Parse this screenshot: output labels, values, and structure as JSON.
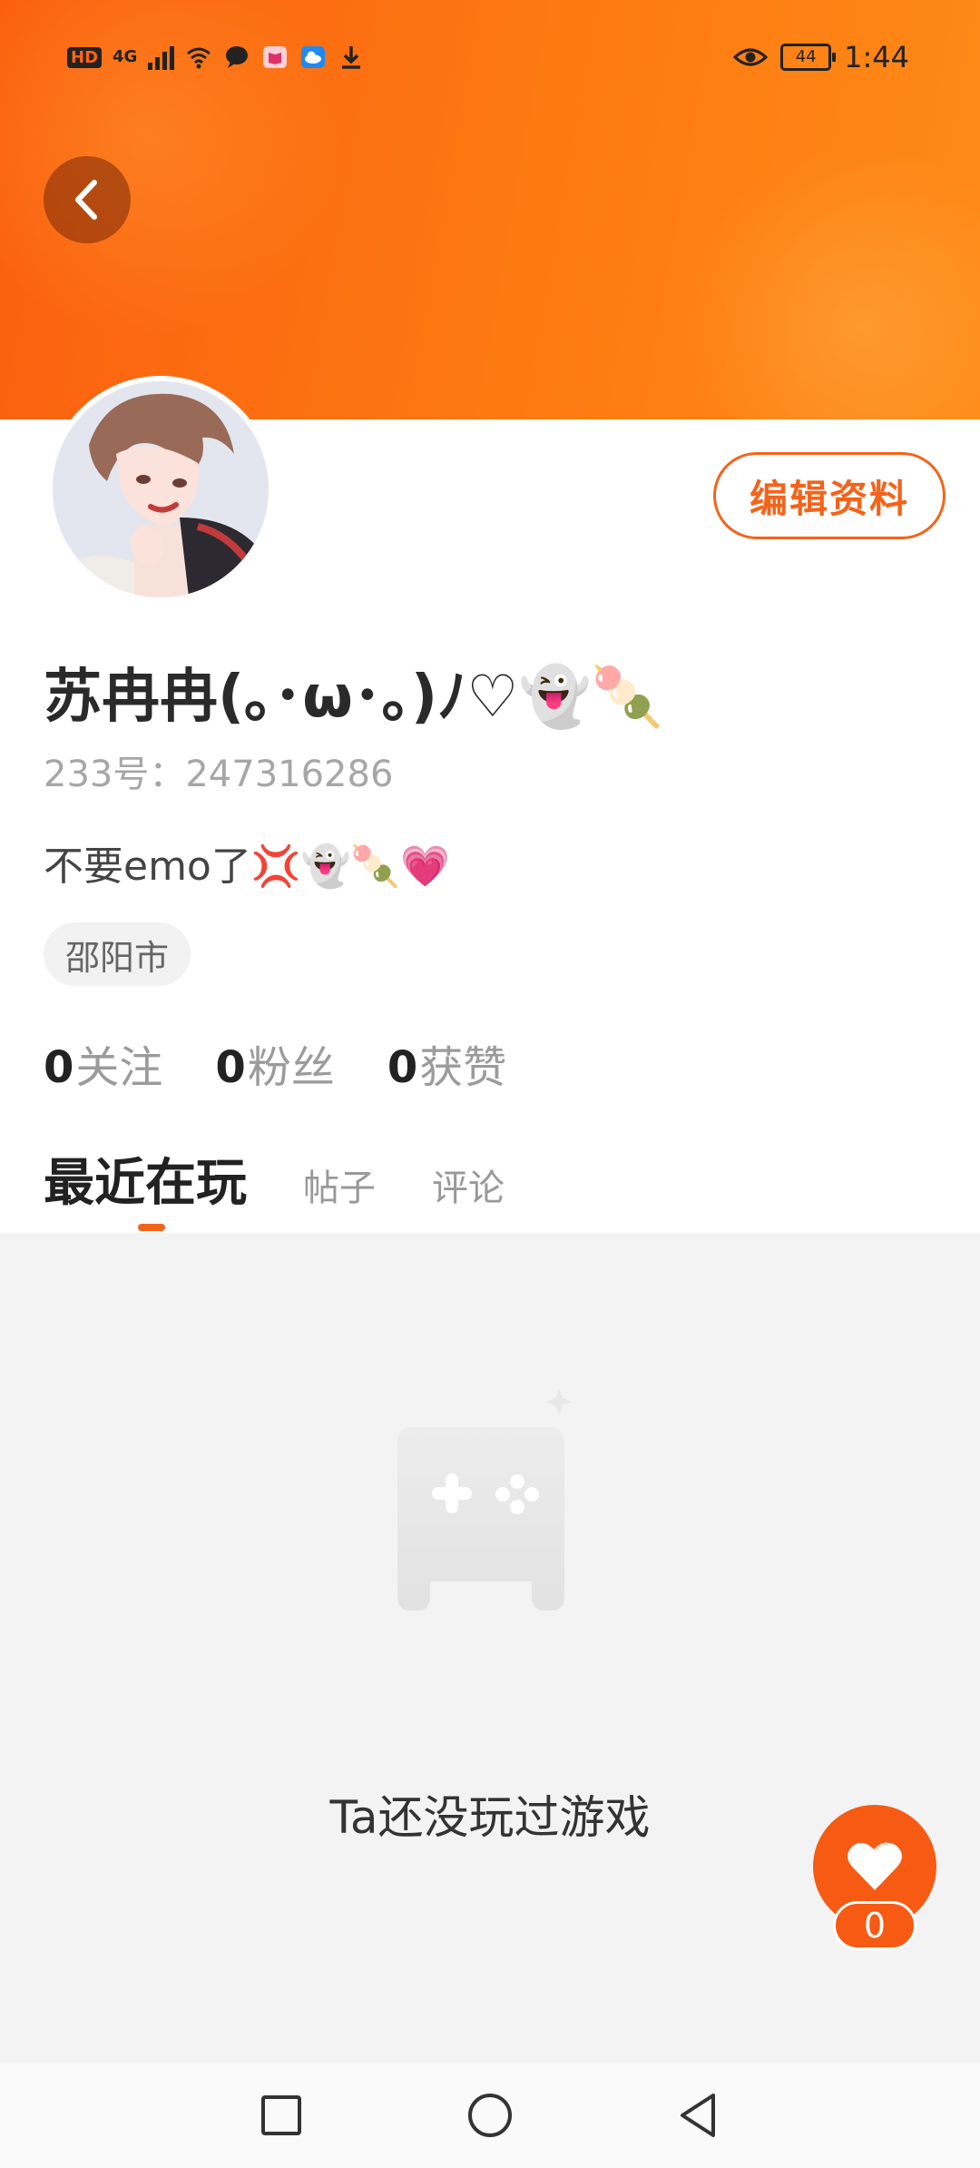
{
  "status_bar": {
    "hd": "HD",
    "network": "4G",
    "battery": "44",
    "time": "1:44"
  },
  "profile": {
    "nickname": "苏冉冉(｡･ω･｡)ﾉ♡👻🍡",
    "uid_label": "233号：247316286",
    "bio": "不要emo了💢👻🍡💗",
    "city": "邵阳市",
    "edit_button": "编辑资料",
    "stats": [
      {
        "count": "0",
        "label": "关注"
      },
      {
        "count": "0",
        "label": "粉丝"
      },
      {
        "count": "0",
        "label": "获赞"
      }
    ]
  },
  "tabs": [
    {
      "label": "最近在玩",
      "active": true
    },
    {
      "label": "帖子",
      "active": false
    },
    {
      "label": "评论",
      "active": false
    }
  ],
  "empty_state": {
    "text": "Ta还没玩过游戏",
    "icon": "gamepad-icon"
  },
  "like": {
    "count": "0",
    "icon": "heart-icon"
  },
  "navigation": {
    "icons": [
      "recent-apps-icon",
      "home-icon",
      "back-icon"
    ]
  },
  "colors": {
    "accent": "#f4631a",
    "header_start": "#fb5f0f",
    "header_end": "#ff8a18"
  }
}
